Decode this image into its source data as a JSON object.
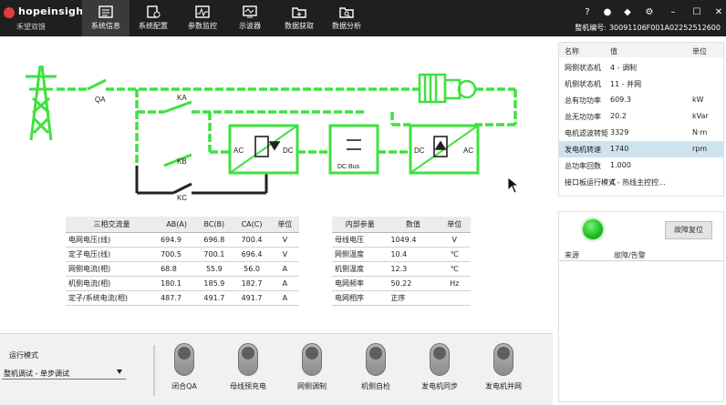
{
  "header": {
    "brand": "hopeinsight",
    "subtitle": "禾望双馈",
    "tabs": [
      {
        "label": "系统信息",
        "icon": "list-icon",
        "active": true
      },
      {
        "label": "系统配置",
        "icon": "config-icon",
        "active": false
      },
      {
        "label": "参数监控",
        "icon": "monitor-icon",
        "active": false
      },
      {
        "label": "示波器",
        "icon": "oscilloscope-icon",
        "active": false
      },
      {
        "label": "数据获取",
        "icon": "folder-download-icon",
        "active": false
      },
      {
        "label": "数据分析",
        "icon": "folder-search-icon",
        "active": false
      }
    ],
    "serial_label": "整机编号:",
    "serial_value": "30091106F001A02252512600",
    "window_icons": [
      "help-icon",
      "user-icon",
      "pin-icon",
      "settings-icon",
      "minimize-icon",
      "maximize-icon",
      "close-icon"
    ]
  },
  "diagram": {
    "qa": "QA",
    "ka": "KA",
    "kb": "KB",
    "kc": "KC",
    "ac_left": "AC",
    "dc_left": "DC",
    "dc_bus": "DC Bus",
    "dc_right": "DC",
    "ac_right": "AC",
    "active_color": "#3ee23e"
  },
  "ac_table": {
    "headers": [
      "三相交流量",
      "AB(A)",
      "BC(B)",
      "CA(C)",
      "单位"
    ],
    "rows": [
      [
        "电网电压(线)",
        "694.9",
        "696.8",
        "700.4",
        "V"
      ],
      [
        "定子电压(线)",
        "700.5",
        "700.1",
        "696.4",
        "V"
      ],
      [
        "网侧电流(相)",
        "68.8",
        "55.9",
        "56.0",
        "A"
      ],
      [
        "机侧电流(相)",
        "180.1",
        "185.9",
        "182.7",
        "A"
      ],
      [
        "定子/系统电流(相)",
        "487.7",
        "491.7",
        "491.7",
        "A"
      ]
    ]
  },
  "internal_table": {
    "headers": [
      "内部参量",
      "数值",
      "单位"
    ],
    "rows": [
      [
        "母线电压",
        "1049.4",
        "V"
      ],
      [
        "网侧温度",
        "10.4",
        "℃"
      ],
      [
        "机侧温度",
        "12.3",
        "℃"
      ],
      [
        "电网频率",
        "50.22",
        "Hz"
      ],
      [
        "电网相序",
        "正序",
        ""
      ]
    ]
  },
  "params": {
    "headers": [
      "名称",
      "值",
      "单位"
    ],
    "rows": [
      {
        "name": "网侧状态机",
        "value": "4 - 调制",
        "unit": ""
      },
      {
        "name": "机侧状态机",
        "value": "11 - 并网",
        "unit": ""
      },
      {
        "name": "总有功功率",
        "value": "609.3",
        "unit": "kW"
      },
      {
        "name": "总无功功率",
        "value": "20.2",
        "unit": "kVar"
      },
      {
        "name": "电机滤波转矩",
        "value": "3329",
        "unit": "N·m"
      },
      {
        "name": "发电机转速",
        "value": "1740",
        "unit": "rpm"
      },
      {
        "name": "总功率回数",
        "value": "1.000",
        "unit": ""
      },
      {
        "name": "接口板运行模式",
        "value": "4 - 热线主控控...",
        "unit": ""
      }
    ],
    "selected_index": 5
  },
  "fault": {
    "reset_label": "故障复位",
    "col_source": "来源",
    "col_fault": "故障/告警",
    "led_color": "#21c021"
  },
  "control": {
    "mode_label": "运行模式",
    "mode_value": "整机调试 - 单步调试",
    "switches": [
      "闭合QA",
      "母线预充电",
      "网侧调制",
      "机侧自检",
      "发电机同步",
      "发电机并网"
    ]
  }
}
